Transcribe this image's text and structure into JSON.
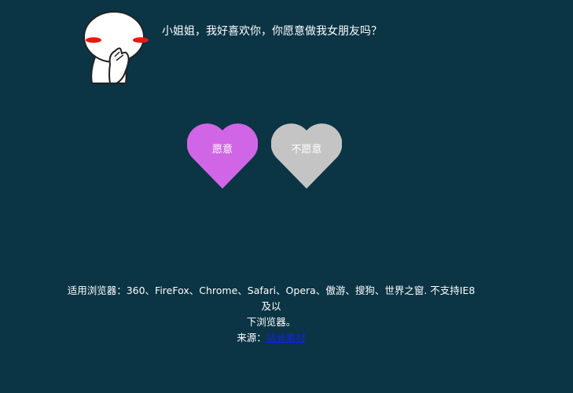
{
  "avatar": {
    "icon": "shy-cartoon-face-icon"
  },
  "question": {
    "text": "小姐姐，我好喜欢你，你愿意做我女朋友吗？"
  },
  "buttons": {
    "yes": {
      "label": "愿意",
      "color": "#d066e6",
      "icon": "heart-icon"
    },
    "no": {
      "label": "不愿意",
      "color": "#c4c4c4",
      "icon": "heart-icon"
    }
  },
  "footer": {
    "compat_line1": "适用浏览器：360、FireFox、Chrome、Safari、Opera、傲游、搜狗、世界之窗. 不支持IE8及以",
    "compat_line2": "下浏览器。",
    "source_prefix": "来源：",
    "source_link_text": "站长素材"
  },
  "colors": {
    "background": "#0b3444",
    "text": "#ffffff",
    "link": "#1a1aff",
    "cheek": "#e8190f"
  }
}
